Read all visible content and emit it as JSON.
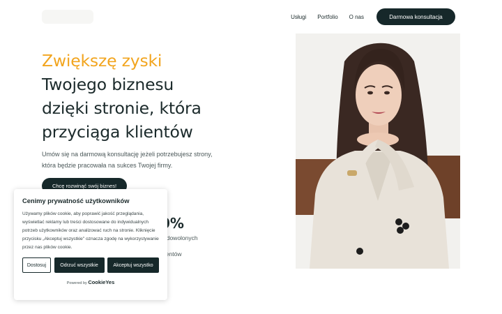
{
  "nav": {
    "items": [
      "Usługi",
      "Portfolio",
      "O nas"
    ],
    "cta": "Darmowa konsultacja"
  },
  "hero": {
    "accent": "Zwiększę zyski",
    "line1": "Twojego biznesu",
    "line2": "dzięki stronie, która",
    "line3": "przyciąga klientów",
    "subtitle": "Umów się na darmową konsultację jeżeli potrzebujesz strony, która będzie pracowała na sukces Twojej firmy.",
    "button": "Chcę rozwinąć swój biznes!",
    "stat_value": "0%",
    "stat_label1": "adowolonych",
    "stat_label2": "lientów"
  },
  "cookie": {
    "title": "Cenimy prywatność użytkowników",
    "text": "Używamy plików cookie, aby poprawić jakość przeglądania, wyświetlać reklamy lub treści dostosowane do indywidualnych potrzeb użytkowników oraz analizować ruch na stronie. Kliknięcie przycisku „Akceptuj wszystkie\" oznacza zgodę na wykorzystywanie przez nas plików cookie.",
    "customize": "Dostosuj",
    "reject": "Odrzuć wszystkie",
    "accept": "Akceptuj wszystko",
    "powered_by": "Powered by",
    "brand": "CookieYes"
  },
  "colors": {
    "accent": "#f2a51f",
    "dark": "#16282a"
  }
}
